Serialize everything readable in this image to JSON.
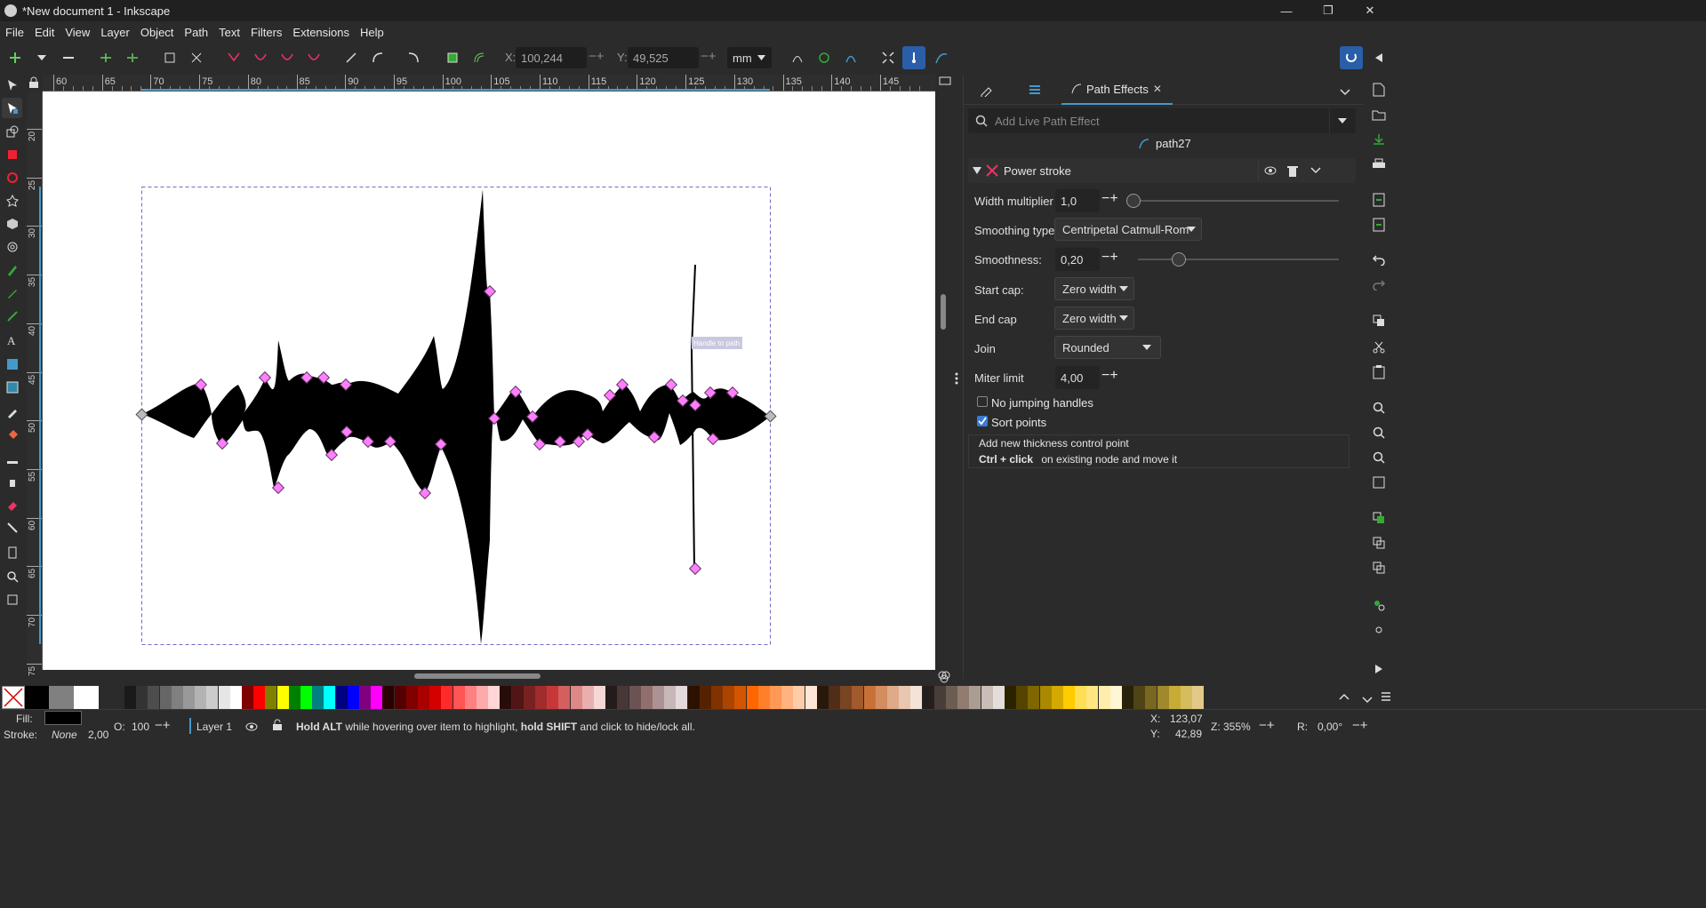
{
  "window": {
    "title": "*New document 1 - Inkscape"
  },
  "menu": [
    "File",
    "Edit",
    "View",
    "Layer",
    "Object",
    "Path",
    "Text",
    "Filters",
    "Extensions",
    "Help"
  ],
  "toolbar": {
    "x_label": "X:",
    "x_value": "100,244",
    "y_label": "Y:",
    "y_value": "49,525",
    "unit": "mm"
  },
  "ruler": {
    "h_ticks": [
      "60",
      "65",
      "70",
      "75",
      "80",
      "85",
      "90",
      "95",
      "100",
      "105",
      "110",
      "115",
      "120",
      "125",
      "130",
      "135",
      "140",
      "145"
    ],
    "v_ticks": [
      "20",
      "25",
      "30",
      "35",
      "40",
      "45",
      "50",
      "55",
      "60",
      "65",
      "70",
      "75"
    ]
  },
  "canvas": {
    "handle_tooltip": "Handle to path"
  },
  "panel": {
    "tab_label": "Path Effects",
    "search_placeholder": "Add Live Path Effect",
    "path_name": "path27",
    "effect_name": "Power stroke",
    "width_multiplier": {
      "label": "Width multiplier",
      "value": "1,0",
      "slider_fraction": 0.0
    },
    "smoothing_type": {
      "label": "Smoothing type",
      "value": "Centripetal Catmull-Rom"
    },
    "smoothness": {
      "label": "Smoothness:",
      "value": "0,20",
      "slider_fraction": 0.2
    },
    "start_cap": {
      "label": "Start cap:",
      "value": "Zero width"
    },
    "end_cap": {
      "label": "End cap",
      "value": "Zero width"
    },
    "join": {
      "label": "Join",
      "value": "Rounded"
    },
    "miter_limit": {
      "label": "Miter limit",
      "value": "4,00"
    },
    "no_jumping": {
      "label": "No jumping handles",
      "checked": false
    },
    "sort_points": {
      "label": "Sort points",
      "checked": true
    },
    "help_line1": "Add new thickness control point",
    "help_key": "Ctrl + click",
    "help_rest": " on existing node and move it"
  },
  "palette": [
    "#000000",
    "#808080",
    "#ffffff",
    "#ff0000",
    "#ffff00",
    "#00ff00",
    "#00ffff",
    "#0000ff",
    "#ff00ff"
  ],
  "status": {
    "fill_label": "Fill:",
    "stroke_label": "Stroke:",
    "stroke_value": "None",
    "stroke_width": "2,00",
    "opacity_label": "O:",
    "opacity_value": "100",
    "layer": "Layer 1",
    "message_bold1": "Hold ALT",
    "message_mid": " while hovering over item to highlight, ",
    "message_bold2": "hold SHIFT",
    "message_end": " and click to hide/lock all.",
    "cursor_x_label": "X:",
    "cursor_x": "123,07",
    "cursor_y_label": "Y:",
    "cursor_y": "42,89",
    "zoom_label": "Z:",
    "zoom": "355%",
    "rotation_label": "R:",
    "rotation": "0,00°"
  }
}
